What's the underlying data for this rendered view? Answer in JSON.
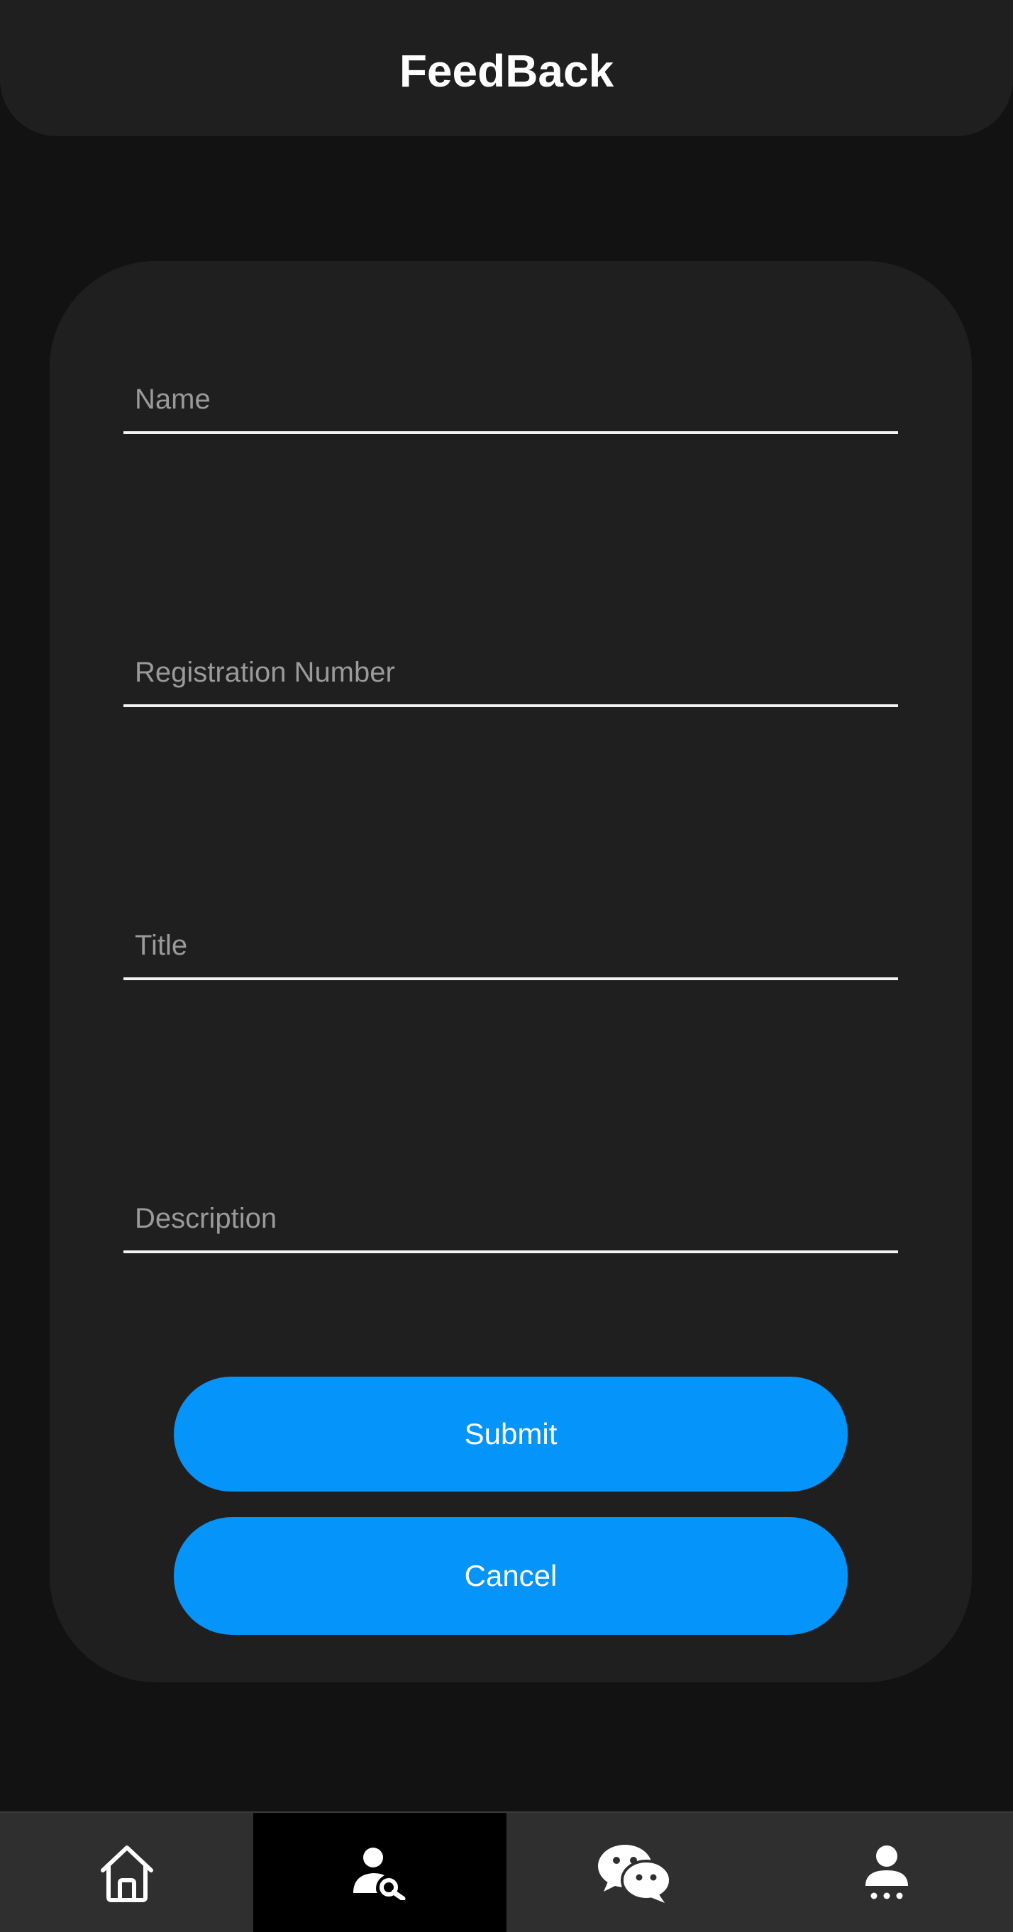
{
  "header": {
    "title": "FeedBack"
  },
  "form": {
    "fields": [
      {
        "placeholder": "Name",
        "value": ""
      },
      {
        "placeholder": "Registration Number",
        "value": ""
      },
      {
        "placeholder": "Title",
        "value": ""
      },
      {
        "placeholder": "Description",
        "value": ""
      }
    ],
    "submit_label": "Submit",
    "cancel_label": "Cancel"
  },
  "bottom_nav": {
    "items": [
      {
        "icon": "home-icon",
        "active": false
      },
      {
        "icon": "person-search-icon",
        "active": true
      },
      {
        "icon": "chat-icon",
        "active": false
      },
      {
        "icon": "person-menu-icon",
        "active": false
      }
    ]
  },
  "colors": {
    "background": "#121212",
    "surface": "#1f1f1f",
    "accent": "#0594fa",
    "nav_background": "#2f2f2f",
    "nav_active": "#000000"
  }
}
